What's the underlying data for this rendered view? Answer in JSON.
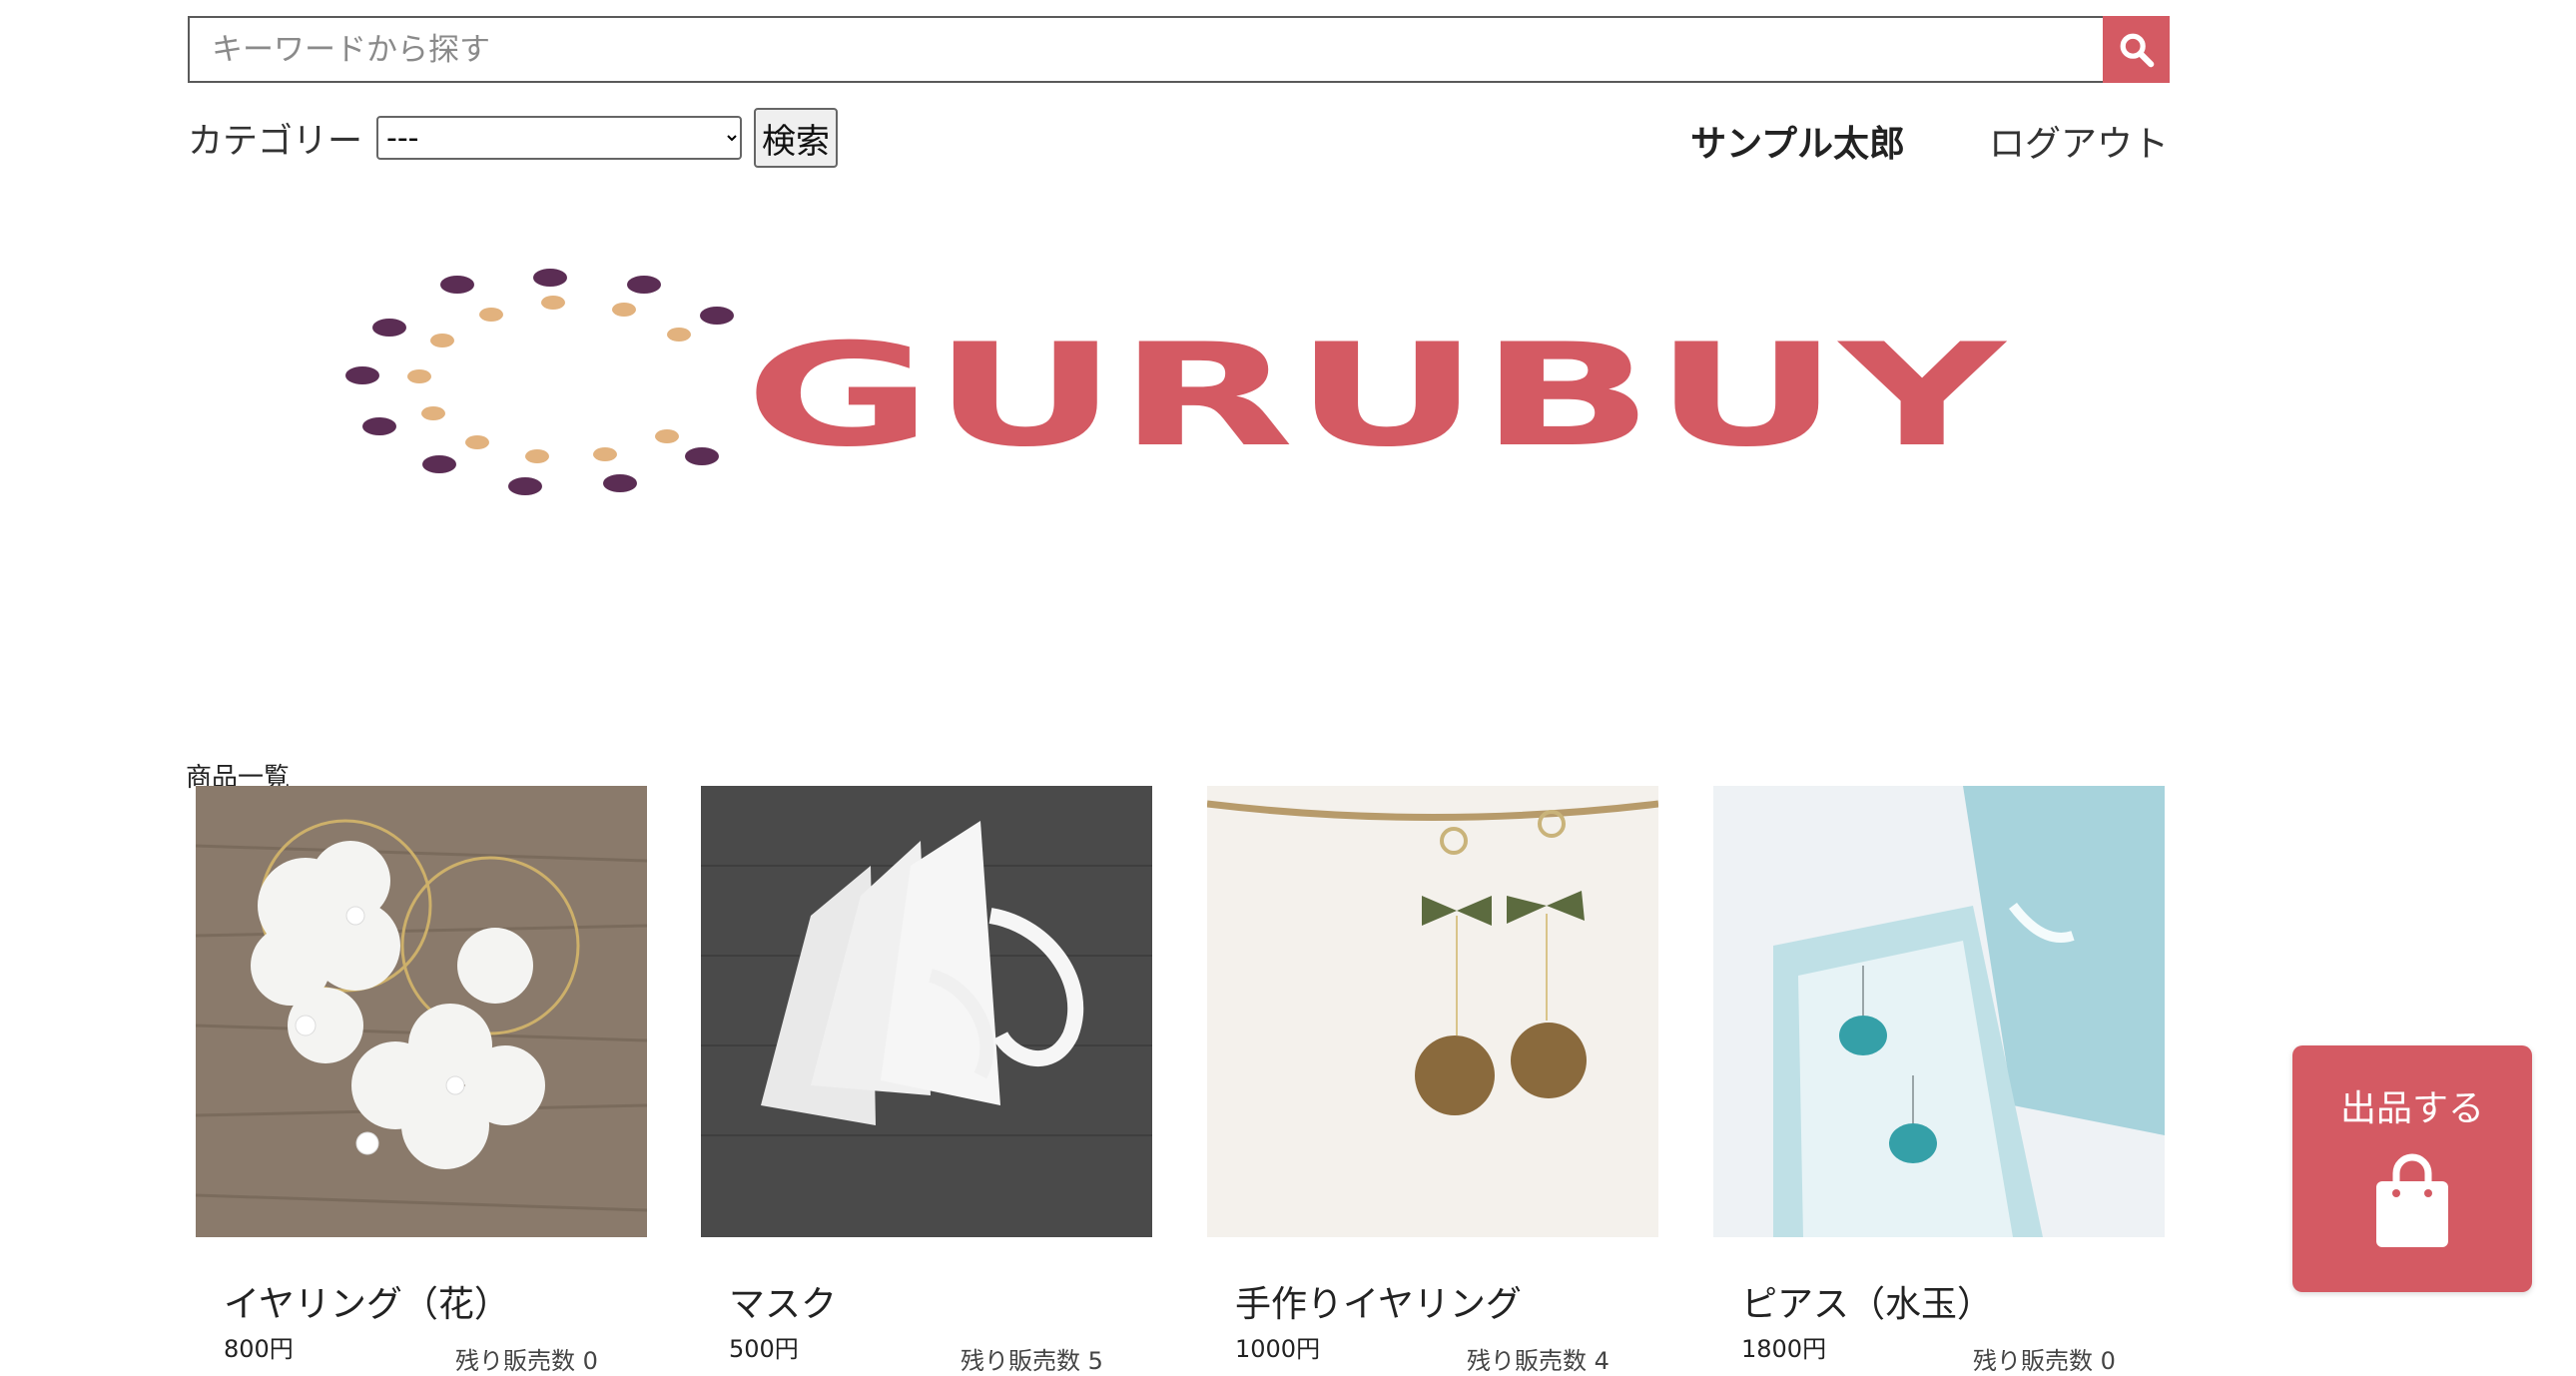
{
  "search": {
    "placeholder": "キーワードから探す"
  },
  "filter": {
    "category_label": "カテゴリー",
    "category_selected": "---",
    "search_button": "検索"
  },
  "header": {
    "user_name": "サンプル太郎",
    "logout": "ログアウト"
  },
  "logo": {
    "text": "GURUBUY"
  },
  "main": {
    "section_title": "商品一覧",
    "products": [
      {
        "name": "イヤリング（花）",
        "price": "800円",
        "stock": "残り販売数 0"
      },
      {
        "name": "マスク",
        "price": "500円",
        "stock": "残り販売数 5"
      },
      {
        "name": "手作りイヤリング",
        "price": "1000円",
        "stock": "残り販売数 4"
      },
      {
        "name": "ピアス（水玉）",
        "price": "1800円",
        "stock": "残り販売数 0"
      }
    ]
  },
  "sell_button": {
    "label": "出品する"
  },
  "colors": {
    "brand": "#d45a63",
    "logo_dark": "#5b2d54",
    "logo_light": "#e2b27e"
  }
}
